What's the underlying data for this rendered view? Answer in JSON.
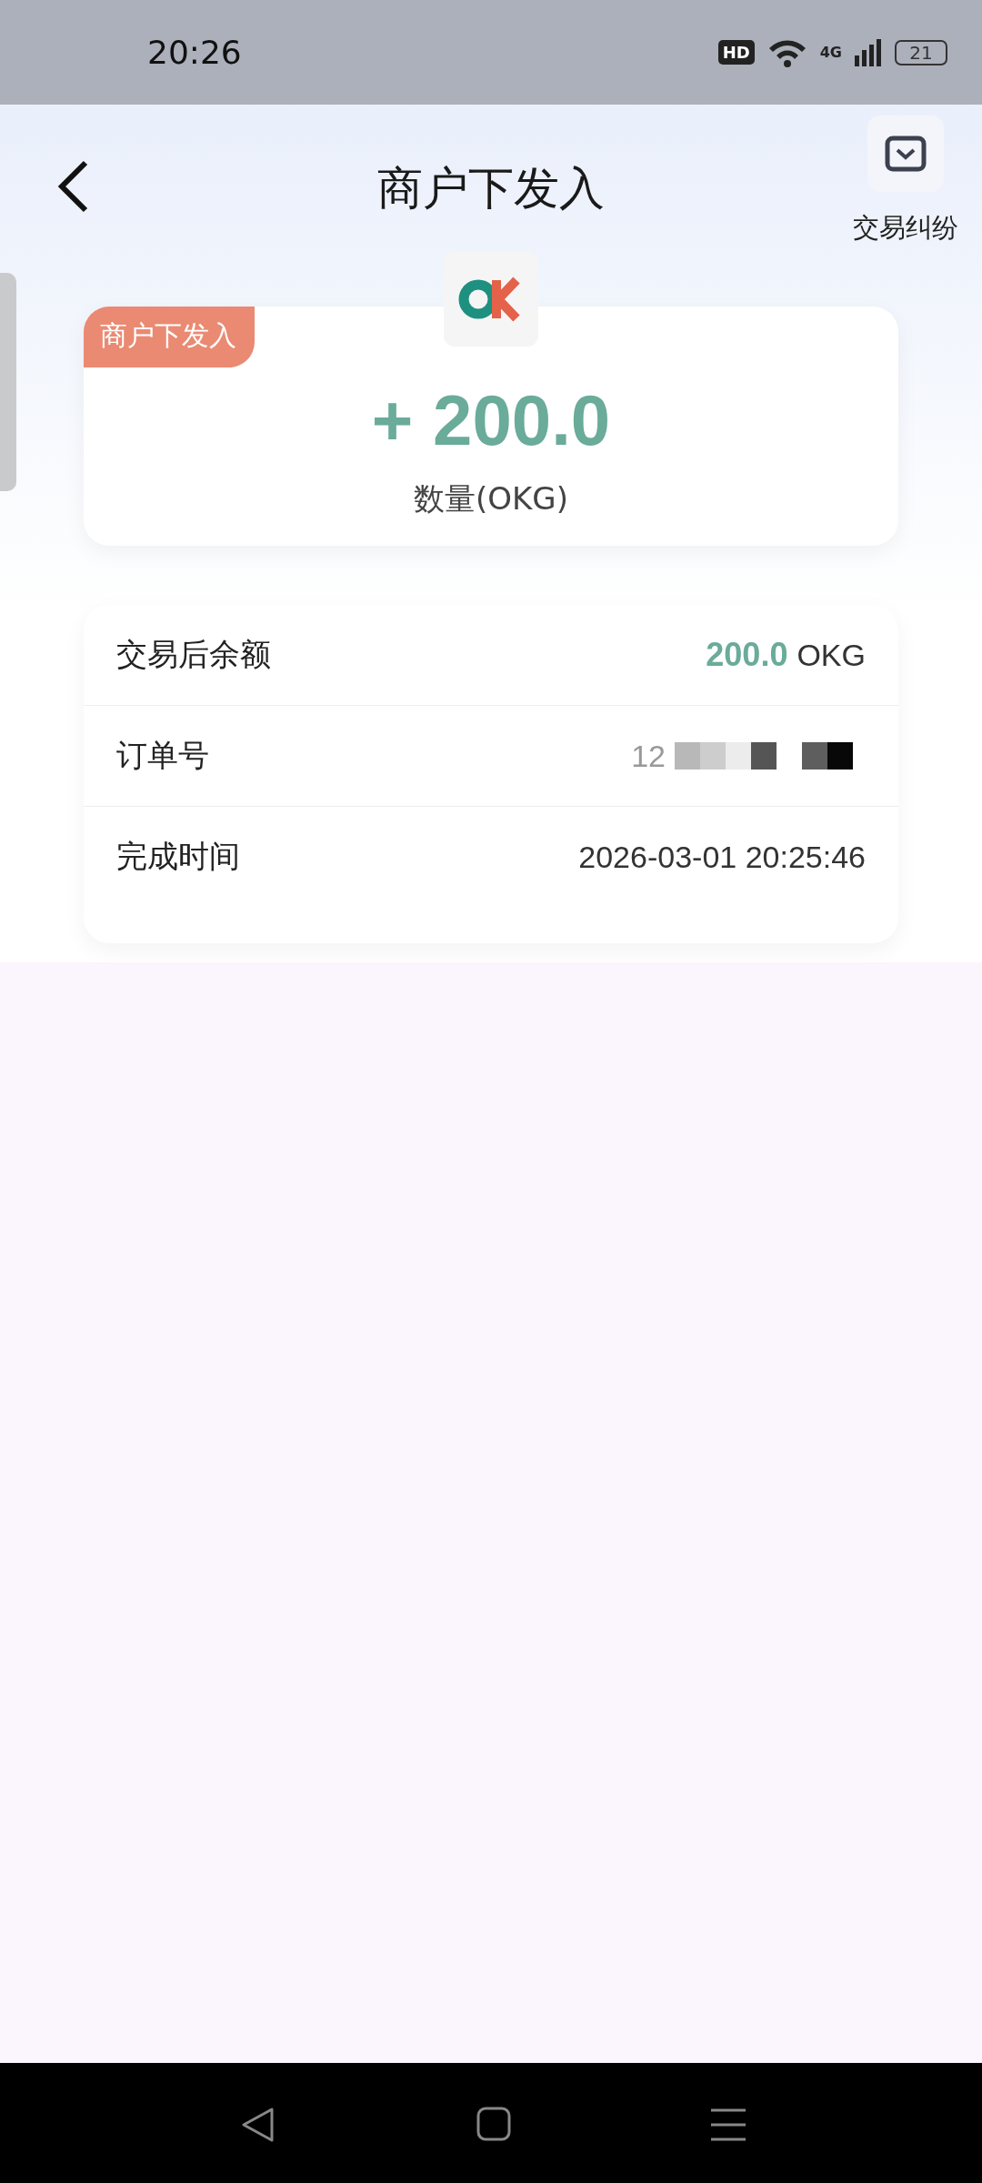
{
  "status_bar": {
    "time": "20:26",
    "badge": "HD",
    "network": "4G",
    "battery": "21"
  },
  "header": {
    "title": "商户下发入",
    "action_label": "交易纠纷"
  },
  "summary": {
    "tag": "商户下发入",
    "amount": "+ 200.0",
    "unit_label": "数量(OKG)"
  },
  "details": [
    {
      "kind": "amount",
      "label": "交易后余额",
      "value": "200.0",
      "unit": "OKG"
    },
    {
      "kind": "redacted",
      "label": "订单号",
      "value": "12"
    },
    {
      "kind": "plain",
      "label": "完成时间",
      "value": "2026-03-01 20:25:46"
    }
  ]
}
